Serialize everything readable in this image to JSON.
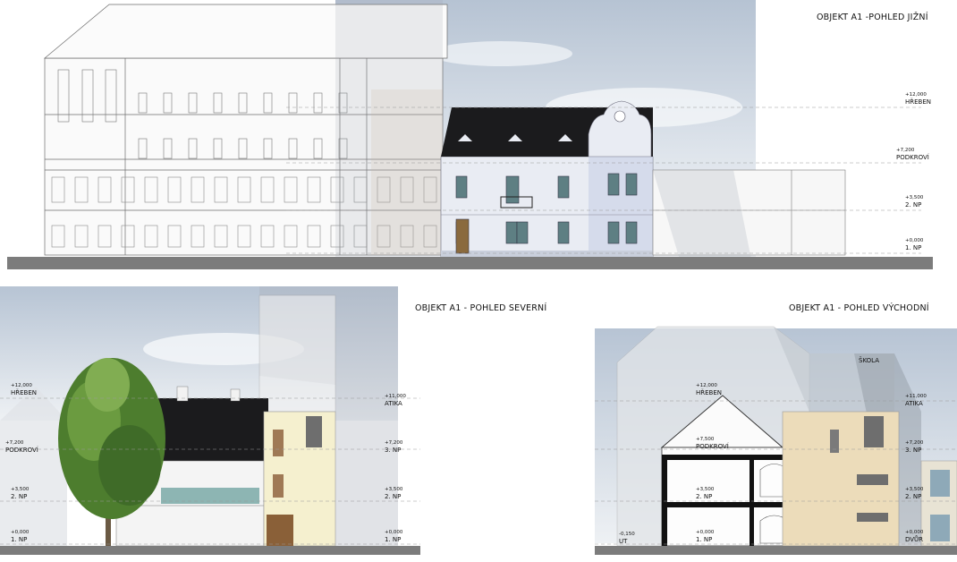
{
  "titles": {
    "south": "OBJEKT A1 -POHLED JIŽNÍ",
    "north": "OBJEKT A1 - POHLED SEVERNÍ",
    "east": "OBJEKT A1 - POHLED VÝCHODNÍ"
  },
  "south_levels": [
    {
      "value": "+12,000",
      "name": "HŘEBEN"
    },
    {
      "value": "+7,200",
      "name": "PODKROVÍ"
    },
    {
      "value": "+3,500",
      "name": "2. NP"
    },
    {
      "value": "+0,000",
      "name": "1. NP"
    }
  ],
  "north_levels_left": [
    {
      "value": "+12,000",
      "name": "HŘEBEN"
    },
    {
      "value": "+7,200",
      "name": "PODKROVÍ"
    },
    {
      "value": "+3,500",
      "name": "2. NP"
    },
    {
      "value": "+0,000",
      "name": "1. NP"
    }
  ],
  "north_levels_right": [
    {
      "value": "+11,000",
      "name": "ATIKA"
    },
    {
      "value": "+7,200",
      "name": "3. NP"
    },
    {
      "value": "+3,500",
      "name": "2. NP"
    },
    {
      "value": "+0,000",
      "name": "1. NP"
    }
  ],
  "east_levels_left": [
    {
      "value": "+12,000",
      "name": "HŘEBEN"
    },
    {
      "value": "+7,500",
      "name": "PODKROVÍ"
    },
    {
      "value": "+3,500",
      "name": "2. NP"
    },
    {
      "value": "+0,000",
      "name": "1. NP"
    },
    {
      "value": "-0,150",
      "name": "UT"
    }
  ],
  "east_levels_right": [
    {
      "value": "+11,000",
      "name": "ATIKA"
    },
    {
      "value": "+7,200",
      "name": "3. NP"
    },
    {
      "value": "+3,500",
      "name": "2. NP"
    },
    {
      "value": "+0,000",
      "name": "DVŮR"
    }
  ],
  "east_label_school": "ŠKOLA",
  "colors": {
    "roof": "#1b1b1d",
    "facade": "#e9ecf3",
    "yellow_wing": "#f5f0cf",
    "beige_wing": "#ecdcba",
    "sky": "#c9d3df",
    "ground": "#7c7c7c"
  }
}
